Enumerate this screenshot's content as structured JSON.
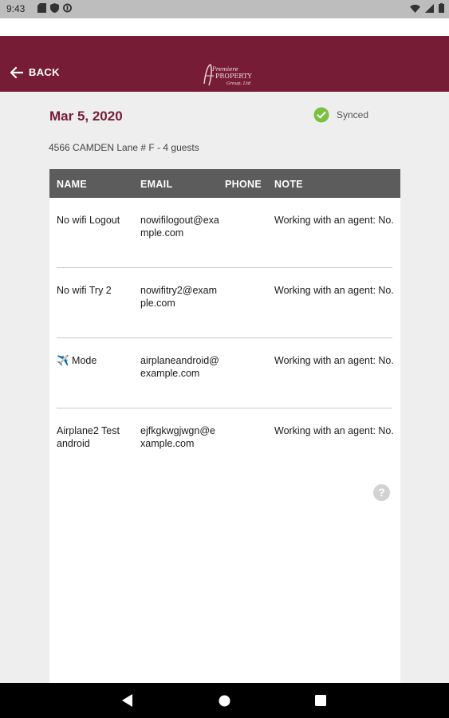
{
  "status_bar": {
    "time": "9:43",
    "left_icons": [
      "sd-card-icon",
      "shield-icon",
      "data-saver-icon"
    ],
    "right_icons": [
      "wifi-icon",
      "signal-icon",
      "battery-icon"
    ]
  },
  "header": {
    "back_label": "BACK",
    "brand_color": "#761c37",
    "logo": "Premiere Property Group logo"
  },
  "event": {
    "date": "Mar 5, 2020",
    "sync_label": "Synced",
    "sync_color": "#7ac143",
    "address": "4566 CAMDEN Lane # F - 4 guests"
  },
  "table": {
    "columns": [
      "NAME",
      "EMAIL",
      "PHONE",
      "NOTE"
    ],
    "rows": [
      {
        "name": "No wifi  Logout",
        "email": "nowifilogout@example.com",
        "phone": "",
        "note": "Working with an agent: No."
      },
      {
        "name": "No wifi Try 2",
        "email": "nowifitry2@example.com",
        "phone": "",
        "note": "Working with an agent: No."
      },
      {
        "name": "✈️ Mode",
        "email": "airplaneandroid@example.com",
        "phone": "",
        "note": "Working with an agent: No."
      },
      {
        "name": "Airplane2 Test android",
        "email": "ejfkgkwgjwgn@example.com",
        "phone": "",
        "note": "Working with an agent: No."
      }
    ]
  },
  "help_label": "?",
  "nav_bar": {
    "buttons": [
      "back-triangle-icon",
      "home-circle-icon",
      "recents-square-icon"
    ]
  }
}
